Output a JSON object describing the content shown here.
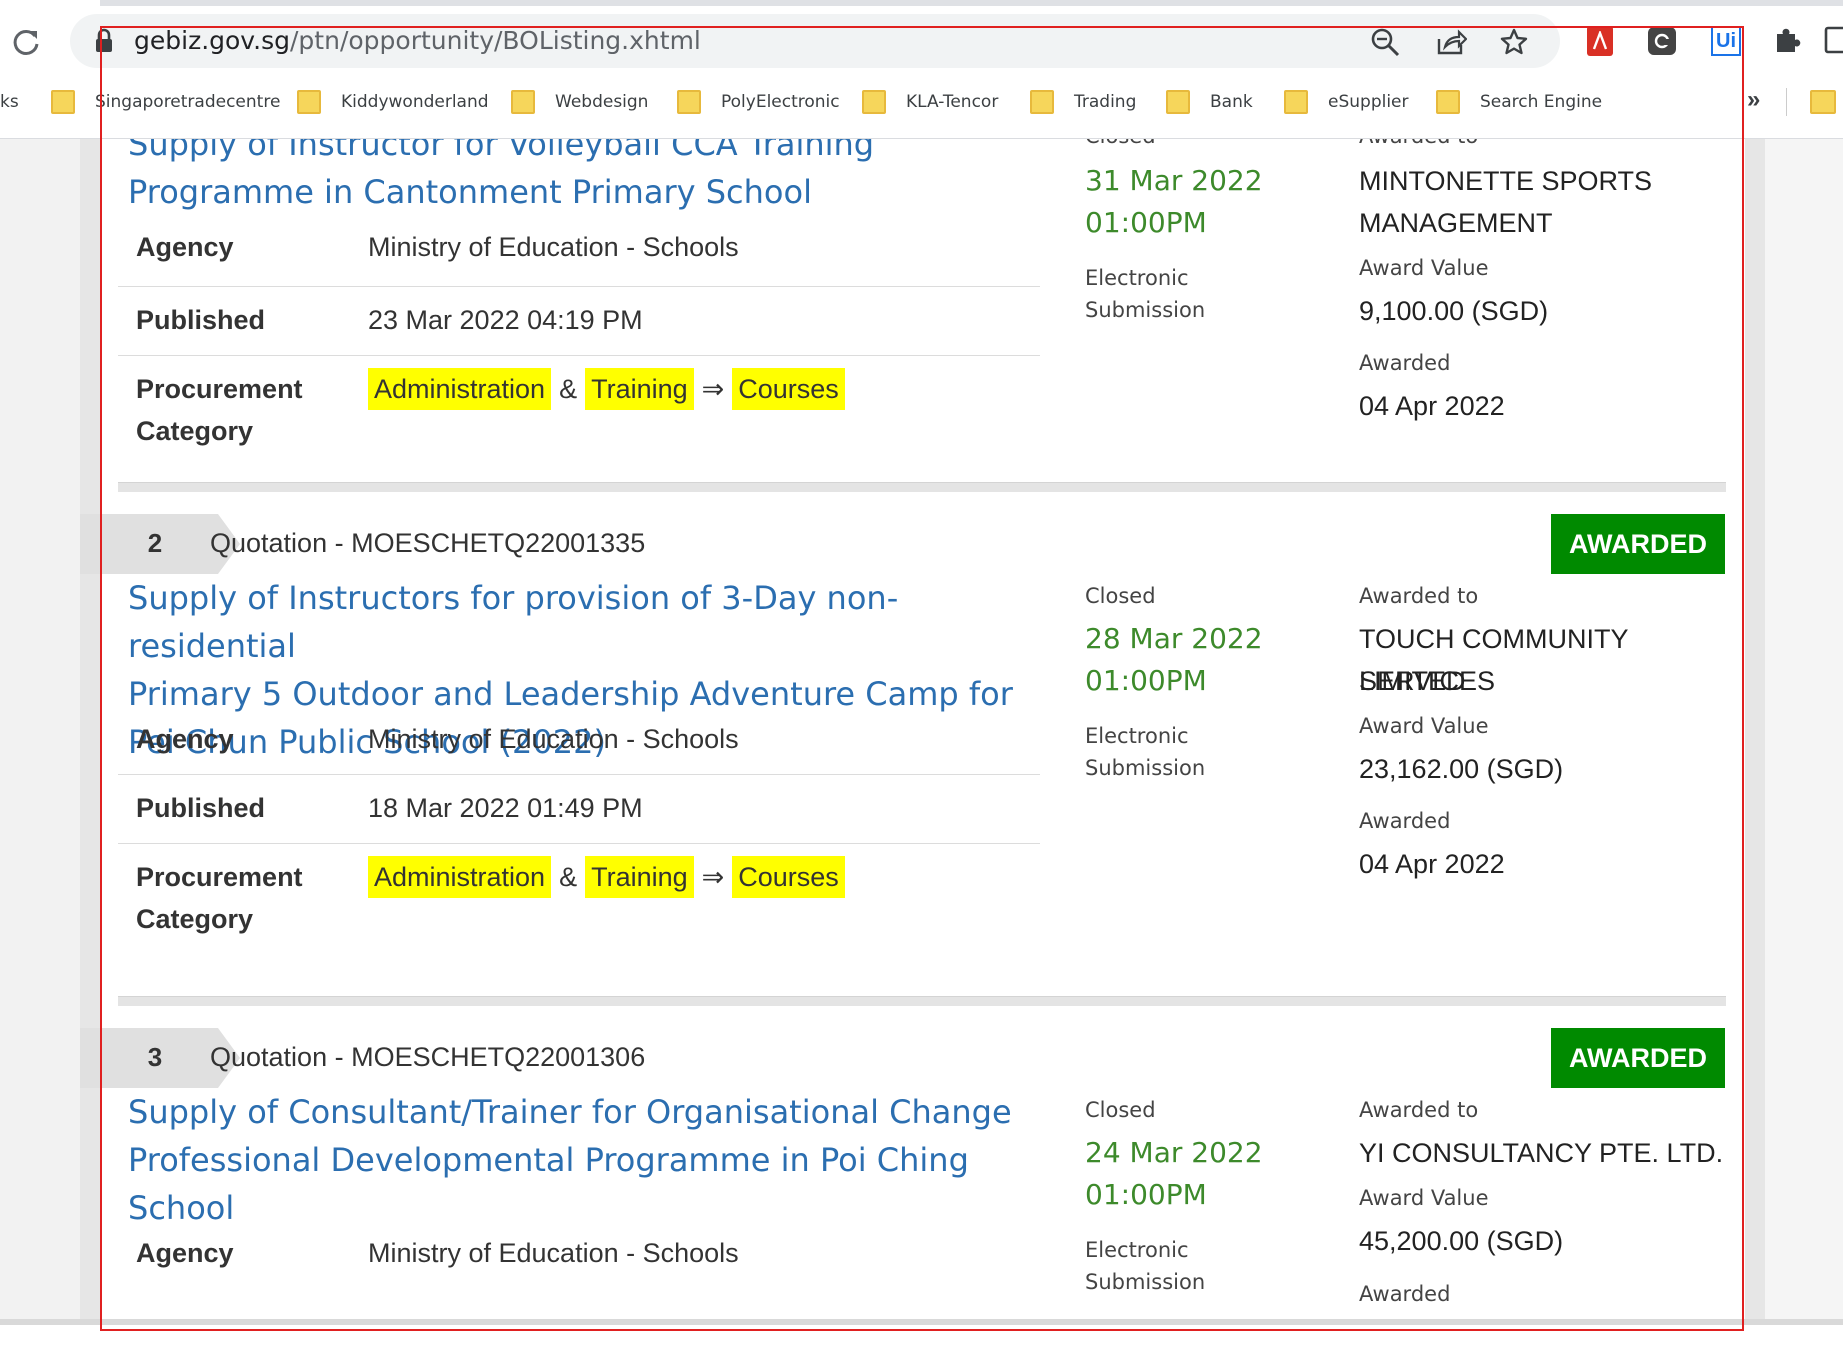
{
  "browser": {
    "url_domain": "gebiz.gov.sg",
    "url_path": "/ptn/opportunity/BOListing.xhtml",
    "bookmarks_cut_left": "ks",
    "bookmarks": [
      "Singaporetradecentre",
      "Kiddywonderland",
      "Webdesign",
      "PolyElectronic",
      "KLA-Tencor",
      "Trading",
      "Bank",
      "eSupplier",
      "Search Engine"
    ],
    "more_bookmarks": "»",
    "extension_ui_label": "Ui"
  },
  "labels": {
    "agency": "Agency",
    "published": "Published",
    "procurement_1": "Procurement",
    "procurement_2": "Category",
    "closed": "Closed",
    "submission_1": "Electronic",
    "submission_2": "Submission",
    "awarded_to": "Awarded to",
    "award_value": "Award Value",
    "awarded": "Awarded",
    "amp": "&",
    "arrow": "⇒"
  },
  "opportunities": [
    {
      "title_line1": "Supply of Instructor for Volleyball CCA Training",
      "title_line2": "Programme in Cantonment Primary School",
      "agency": "Ministry of Education - Schools",
      "published": "23 Mar 2022 04:19 PM",
      "categories": [
        "Administration",
        "Training",
        "Courses"
      ],
      "closed_date": "31 Mar 2022",
      "closed_time": "01:00PM",
      "awarded_to_1": "MINTONETTE SPORTS",
      "awarded_to_2": "MANAGEMENT",
      "award_value": "9,100.00 (SGD)",
      "awarded_date": "04 Apr 2022"
    },
    {
      "number": "2",
      "doc_ref": "Quotation - MOESCHETQ22001335",
      "status": "AWARDED",
      "title_line1": "Supply of Instructors for provision of 3-Day non-residential",
      "title_line2": "Primary 5 Outdoor and Leadership Adventure Camp for",
      "title_line3": "Pei Chun Public School (2022)",
      "agency": "Ministry of Education - Schools",
      "published": "18 Mar 2022 01:49 PM",
      "categories": [
        "Administration",
        "Training",
        "Courses"
      ],
      "closed_date": "28 Mar 2022",
      "closed_time": "01:00PM",
      "awarded_to_1": "TOUCH COMMUNITY SERVICES",
      "awarded_to_2": "LIMITED",
      "award_value": "23,162.00 (SGD)",
      "awarded_date": "04 Apr 2022"
    },
    {
      "number": "3",
      "doc_ref": "Quotation - MOESCHETQ22001306",
      "status": "AWARDED",
      "title_line1": "Supply of Consultant/Trainer for Organisational Change",
      "title_line2": "Professional Developmental Programme in Poi Ching",
      "title_line3": "School",
      "agency": "Ministry of Education - Schools",
      "closed_date": "24 Mar 2022",
      "closed_time": "01:00PM",
      "awarded_to_1": "YI CONSULTANCY PTE. LTD.",
      "award_value": "45,200.00 (SGD)"
    }
  ],
  "colors": {
    "title_link": "#2b6eb0",
    "closed_date": "#3d8a2b",
    "awarded_badge": "#008a00",
    "category_highlight": "#ffff00",
    "annotation_frame": "#e02020"
  }
}
